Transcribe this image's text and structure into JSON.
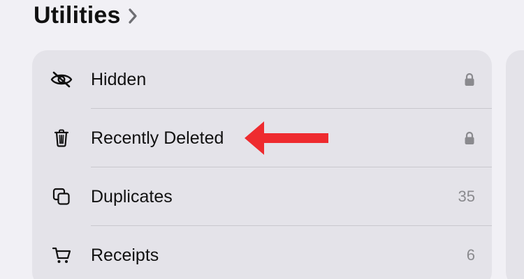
{
  "section": {
    "title": "Utilities"
  },
  "items": [
    {
      "label": "Hidden",
      "icon": "eye-slash-icon",
      "trailing_icon": "lock-icon"
    },
    {
      "label": "Recently Deleted",
      "icon": "trash-icon",
      "trailing_icon": "lock-icon"
    },
    {
      "label": "Duplicates",
      "icon": "duplicates-icon",
      "count": "35"
    },
    {
      "label": "Receipts",
      "icon": "cart-icon",
      "count": "6"
    }
  ],
  "annotation": {
    "arrow_color": "#ee2b2f"
  },
  "colors": {
    "background": "#f1f0f5",
    "card": "#e4e3e9",
    "secondary_text": "#8a8a8e"
  }
}
